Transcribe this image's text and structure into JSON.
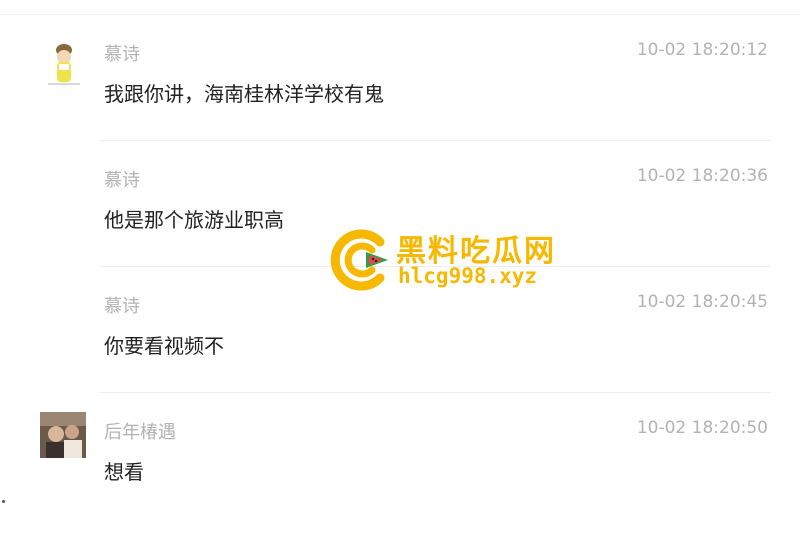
{
  "messages": [
    {
      "name": "慕诗",
      "time": "10-02 18:20:12",
      "text": "我跟你讲，海南桂林洋学校有鬼",
      "avatar": "cartoon-avatar"
    },
    {
      "name": "慕诗",
      "time": "10-02 18:20:36",
      "text": "他是那个旅游业职高",
      "avatar": ""
    },
    {
      "name": "慕诗",
      "time": "10-02 18:20:45",
      "text": "你要看视频不",
      "avatar": ""
    },
    {
      "name": "后年椿遇",
      "time": "10-02 18:20:50",
      "text": "想看",
      "avatar": "photo-avatar"
    }
  ],
  "watermark": {
    "title": "黑料吃瓜网",
    "url": "hlcg998.xyz",
    "color": "#f6b800",
    "accent": "#e8454a"
  }
}
